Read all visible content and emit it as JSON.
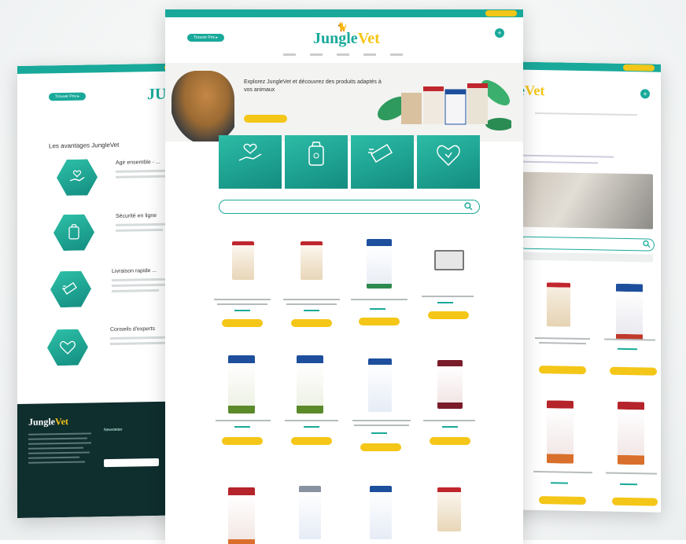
{
  "center_page": {
    "menu_items": [
      "",
      "",
      "",
      "",
      ""
    ],
    "top_pill": "Trouver Prix ▸",
    "hero_title": "Explorez JungleVet et découvrez des produits adaptés à vos animaux",
    "hero_button": "",
    "search_placeholder": "",
    "tiles": [
      {
        "icon": "hand-heart-icon",
        "label": ""
      },
      {
        "icon": "food-bag-icon",
        "label": ""
      },
      {
        "icon": "delivery-box-icon",
        "label": ""
      },
      {
        "icon": "vet-heart-icon",
        "label": ""
      }
    ]
  },
  "left_page": {
    "section_title": "Les avantages JungleVet",
    "features": [
      {
        "icon": "hand-heart-icon",
        "title": "Agir ensemble - ..."
      },
      {
        "icon": "food-bag-icon",
        "title": "Sécurité en ligne"
      },
      {
        "icon": "delivery-box-icon",
        "title": "Livraison rapide ..."
      },
      {
        "icon": "vet-heart-icon",
        "title": "Conseils d'experts"
      }
    ],
    "footer_newsletter": "Newsletter"
  },
  "right_page": {
    "sort_label": ""
  },
  "colors": {
    "brand_teal": "#19a99a",
    "brand_yellow": "#f4c617",
    "footer_dark": "#0f2e2e"
  }
}
